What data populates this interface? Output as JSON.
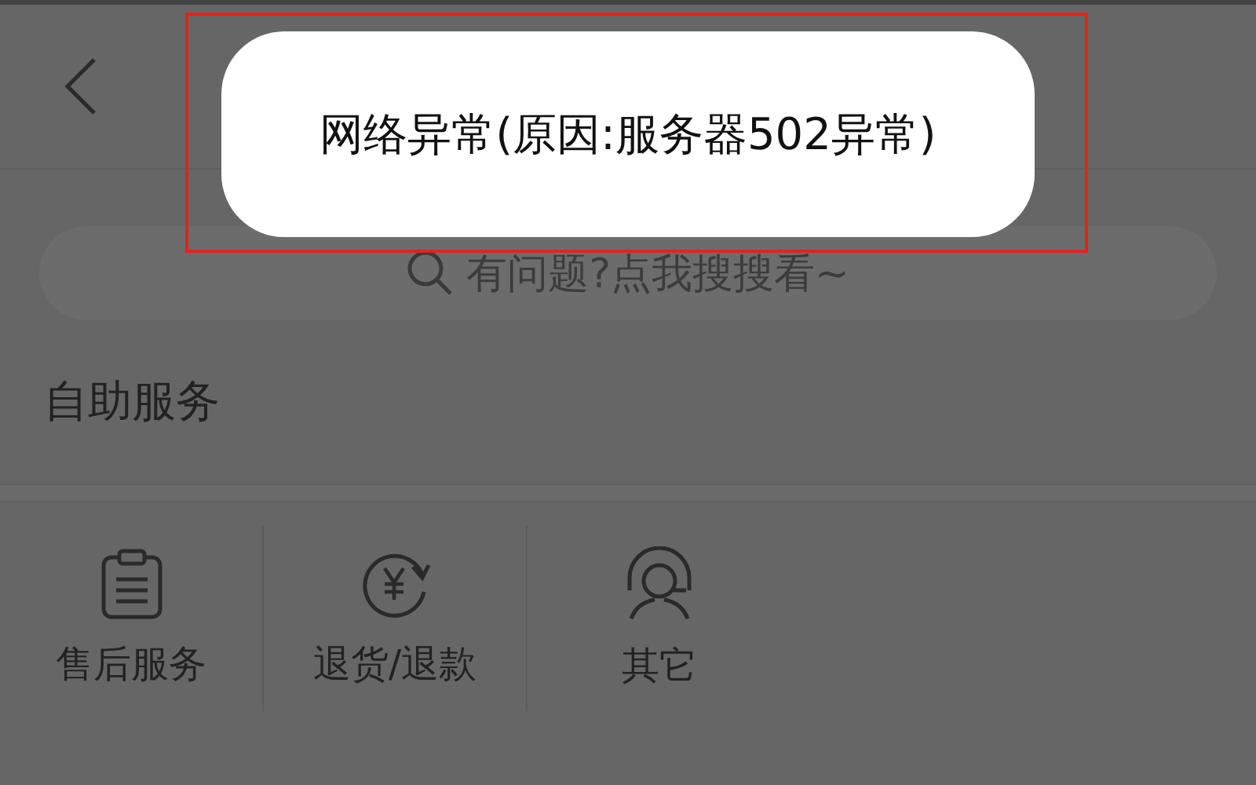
{
  "search": {
    "placeholder": "有问题?点我搜搜看~"
  },
  "section": {
    "title": "自助服务"
  },
  "services": [
    {
      "kind": "clipboard",
      "label": "售后服务"
    },
    {
      "kind": "refund",
      "label": "退货/退款"
    },
    {
      "kind": "agent",
      "label": "其它"
    }
  ],
  "toast": {
    "message": "网络异常(原因:服务器502异常)"
  },
  "annotation": {
    "color": "#e8201c"
  }
}
